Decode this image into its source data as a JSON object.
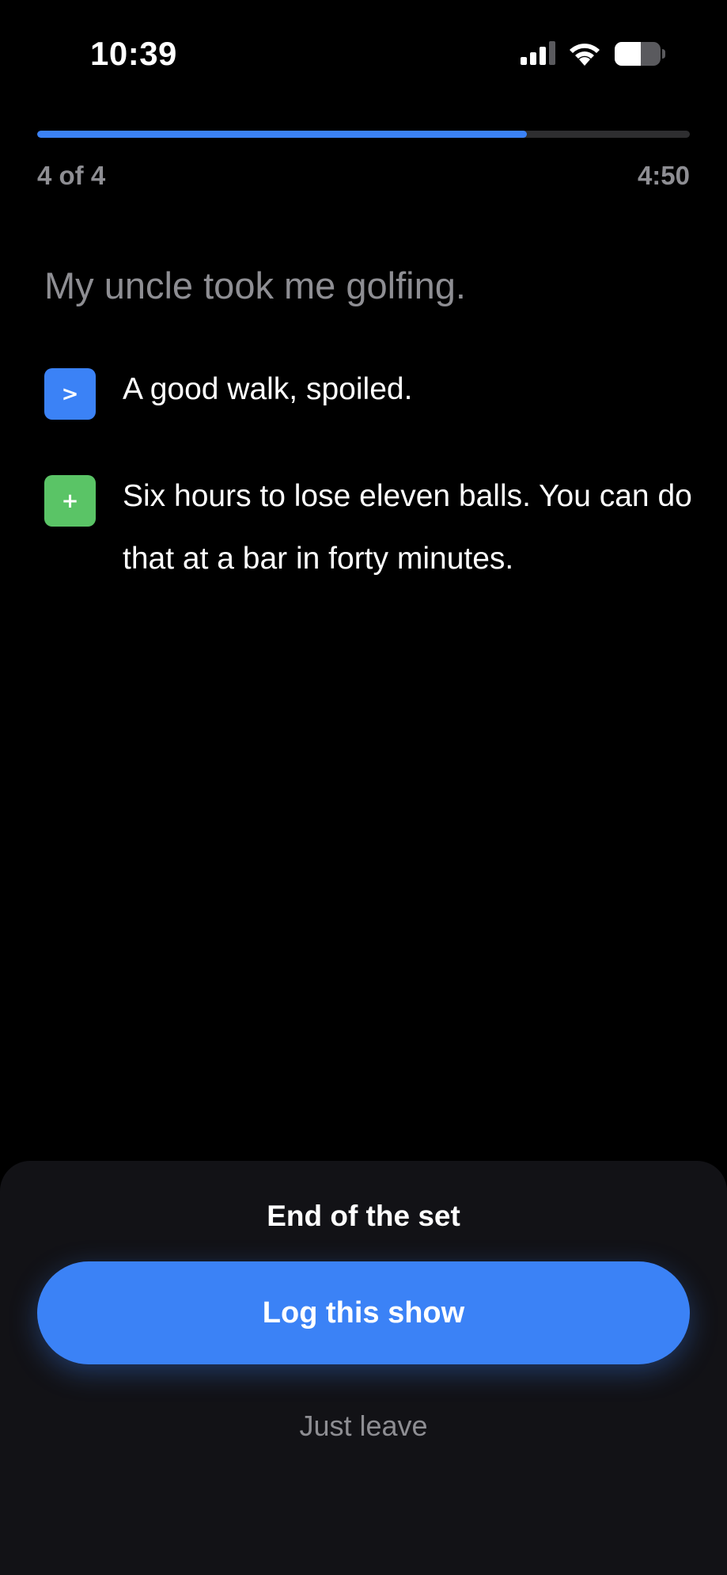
{
  "status_bar": {
    "time": "10:39",
    "icons": [
      "signal-icon",
      "wifi-icon",
      "battery-icon"
    ]
  },
  "progress": {
    "count_label": "4 of 4",
    "fraction": 0.75,
    "time_label": "4:50"
  },
  "joke": {
    "setup": "My uncle took me golfing.",
    "beats": [
      {
        "badge": ">",
        "badge_color": "#3b82f6",
        "text": "A good walk, spoiled."
      },
      {
        "badge": "+",
        "badge_color": "#5ac466",
        "text": "Six hours to lose eleven balls. You can do that at a bar in forty minutes."
      }
    ]
  },
  "sheet": {
    "title": "End of the set",
    "primary_label": "Log this show",
    "secondary_label": "Just leave"
  },
  "colors": {
    "accent": "#3b82f6",
    "background": "#000000",
    "sheet": "#121216",
    "muted_text": "#8e8e93"
  }
}
